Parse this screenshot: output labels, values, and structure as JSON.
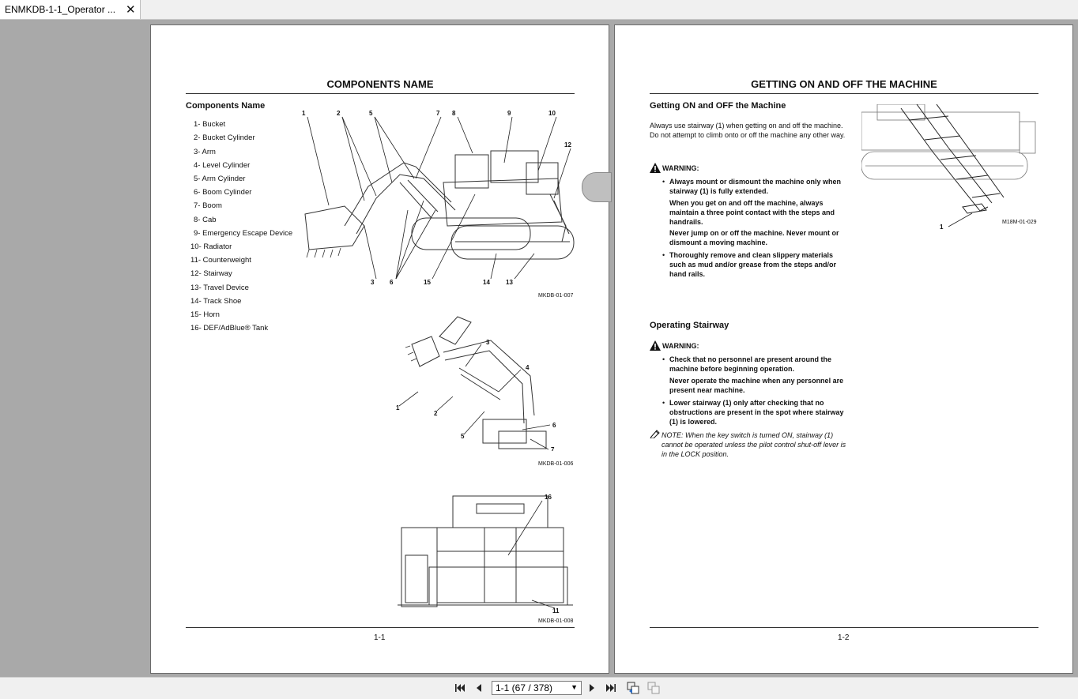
{
  "tab": {
    "title": "ENMKDB-1-1_Operator ...",
    "close": "✕"
  },
  "left_page": {
    "title": "COMPONENTS NAME",
    "subtitle": "Components Name",
    "components": [
      "1-  Bucket",
      "2-  Bucket Cylinder",
      "3-  Arm",
      "4-  Level Cylinder",
      "5-  Arm Cylinder",
      "6-  Boom Cylinder",
      "7-  Boom",
      "8-  Cab",
      "9-  Emergency Escape Device",
      "10-  Radiator",
      "11-  Counterweight",
      "12-  Stairway",
      "13-  Travel Device",
      "14-  Track Shoe",
      "15-  Horn",
      "16-  DEF/AdBlue® Tank"
    ],
    "fig1_id": "MKDB-01-007",
    "fig1_callouts": [
      "1",
      "2",
      "5",
      "7",
      "8",
      "9",
      "10",
      "12",
      "3",
      "6",
      "15",
      "14",
      "13"
    ],
    "fig2_id": "MKDB-01-006",
    "fig2_callouts": [
      "3",
      "4",
      "1",
      "2",
      "5",
      "6",
      "7",
      "8"
    ],
    "fig3_id": "MKDB-01-008",
    "fig3_callouts": [
      "16",
      "11"
    ],
    "page_number": "1-1"
  },
  "right_page": {
    "title": "GETTING ON AND OFF THE MACHINE",
    "section1_heading": "Getting ON and OFF the Machine",
    "section1_intro": "Always use stairway (1) when getting on and off the machine. Do not attempt to climb onto or off the machine any other way.",
    "warning_label": "WARNING:",
    "warning1_items": [
      "Always mount or dismount the machine only when stairway (1) is fully extended.",
      "When you get on and off the machine, always maintain a three point contact with the steps and handrails.",
      "Never jump on or off the machine. Never mount or dismount a moving machine.",
      "Thoroughly remove and clean slippery materials such as mud and/or grease from the steps and/or hand rails."
    ],
    "fig_id": "M18M-01-029",
    "fig_callout": "1",
    "section2_heading": "Operating Stairway",
    "warning2_items": [
      "Check that no personnel are present around the machine before beginning operation.",
      "Never operate the machine when any personnel are present near machine.",
      "Lower stairway (1) only after checking that no obstructions are present in the spot where stairway (1) is lowered."
    ],
    "note": "NOTE:    When the key switch is turned ON, stairway (1) cannot be operated unless the pilot control shut-off lever is in the LOCK position.",
    "page_number": "1-2"
  },
  "toolbar": {
    "page_selector_value": "1-1 (67 / 378)",
    "first_icon": "first-page-icon",
    "prev_icon": "previous-page-icon",
    "next_icon": "next-page-icon",
    "last_icon": "last-page-icon"
  }
}
